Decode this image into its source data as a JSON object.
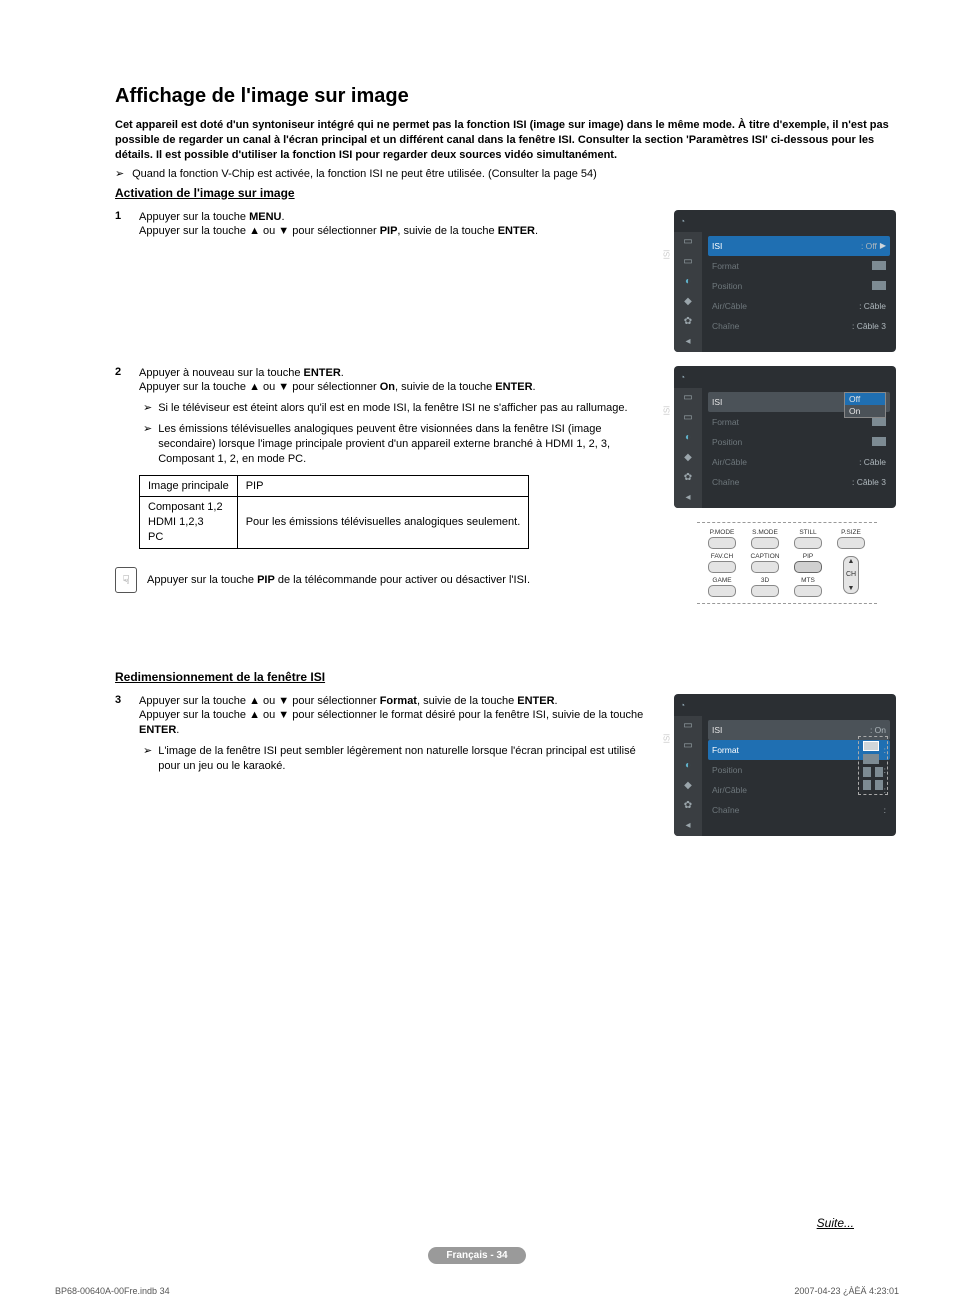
{
  "title": "Affichage de l'image sur image",
  "intro": "Cet appareil est doté d'un syntoniseur intégré qui ne permet pas la fonction ISI (image sur image) dans le même mode. À titre d'exemple, il n'est pas possible de regarder un canal à l'écran principal et un différent canal dans la fenêtre ISI. Consulter la section 'Paramètres ISI' ci-dessous pour les détails. Il est possible d'utiliser la fonction ISI pour regarder deux sources vidéo simultanément.",
  "vchip_note": "Quand la fonction V-Chip est activée, la fonction ISI ne peut être utilisée. (Consulter la page 54)",
  "section1_title": "Activation de l'image sur image",
  "step1_num": "1",
  "step1_l1a": "Appuyer sur la touche ",
  "step1_l1b": "MENU",
  "step1_l1c": ".",
  "step1_l2a": "Appuyer sur la touche ▲ ou ▼ pour sélectionner ",
  "step1_l2b": "PIP",
  "step1_l2c": ", suivie de la touche ",
  "step1_l2d": "ENTER",
  "step1_l2e": ".",
  "step2_num": "2",
  "step2_l1a": "Appuyer à nouveau sur la touche ",
  "step2_l1b": "ENTER",
  "step2_l1c": ".",
  "step2_l2a": "Appuyer sur la touche ▲ ou ▼ pour sélectionner ",
  "step2_l2b": "On",
  "step2_l2c": ", suivie de la touche ",
  "step2_l2d": "ENTER",
  "step2_l2e": ".",
  "step2_b1": "Si le téléviseur est éteint alors qu'il est en mode ISI, la fenêtre ISI ne s'afficher pas au rallumage.",
  "step2_b2": "Les émissions télévisuelles analogiques peuvent être visionnées dans la fenêtre ISI (image secondaire) lorsque l'image principale provient d'un appareil externe branché à HDMI 1, 2, 3, Composant 1, 2, en mode PC.",
  "table": {
    "h1": "Image principale",
    "h2": "PIP",
    "r1c1": "Composant 1,2\nHDMI 1,2,3\nPC",
    "r1c2": "Pour les émissions télévisuelles analogiques seulement."
  },
  "remote_tip_a": "Appuyer sur la touche ",
  "remote_tip_b": "PIP",
  "remote_tip_c": " de la télécommande pour activer ou désactiver l'ISI.",
  "section2_title": "Redimensionnement de la fenêtre ISI",
  "step3_num": "3",
  "step3_l1a": "Appuyer sur la touche ▲ ou ▼ pour sélectionner ",
  "step3_l1b": "Format",
  "step3_l1c": ", suivie de la touche ",
  "step3_l1d": "ENTER",
  "step3_l1e": ".",
  "step3_l2": "Appuyer sur la touche ▲ ou ▼ pour sélectionner le format désiré pour la fenêtre ISI, suivie de la touche ",
  "step3_l2b": "ENTER",
  "step3_l2c": ".",
  "step3_b1": "L'image de la fenêtre ISI peut sembler légèrement non naturelle lorsque l'écran principal est utilisé pour un jeu ou le karaoké.",
  "osd": {
    "isi": "ISI",
    "off": ": Off",
    "on": ": On",
    "format": "Format",
    "position": "Position",
    "aircable": "Air/Câble",
    "aircable_val": ": Câble",
    "chaine": "Chaîne",
    "chaine_val": ": Câble 3",
    "off_opt": "Off",
    "on_opt": "On"
  },
  "remote": {
    "pmode": "P.MODE",
    "smode": "S.MODE",
    "still": "STILL",
    "psize": "P.SIZE",
    "favch": "FAV.CH",
    "caption": "CAPTION",
    "pip": "PIP",
    "game": "GAME",
    "threed": "3D",
    "mts": "MTS",
    "ch": "CH"
  },
  "suite": "Suite...",
  "footer": "Français - 34",
  "meta_left": "BP68-00640A-00Fre.indb   34",
  "meta_right": "2007-04-23   ¿ÀÈÄ 4:23:01"
}
